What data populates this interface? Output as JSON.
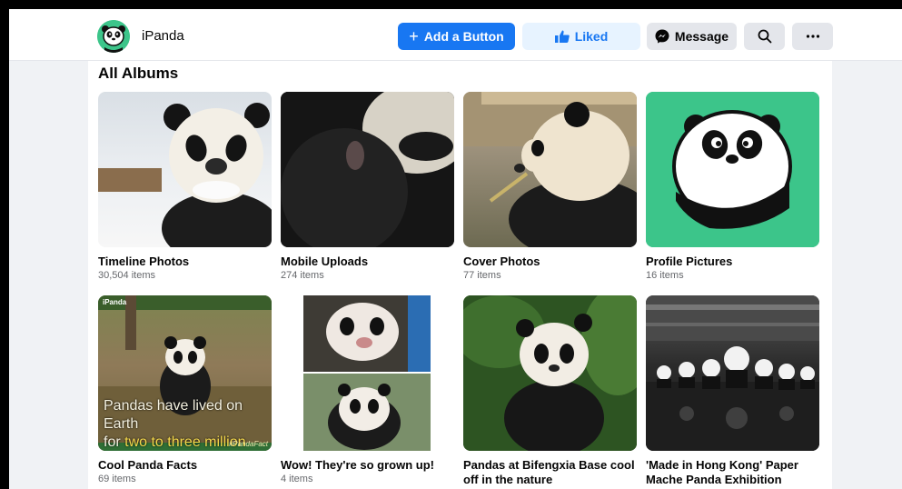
{
  "page": {
    "name": "iPanda"
  },
  "actions": {
    "add_button": "Add a Button",
    "liked": "Liked",
    "message": "Message"
  },
  "section": {
    "title": "All Albums"
  },
  "albums": [
    {
      "title": "Timeline Photos",
      "count": "30,504 items"
    },
    {
      "title": "Mobile Uploads",
      "count": "274 items"
    },
    {
      "title": "Cover Photos",
      "count": "77 items"
    },
    {
      "title": "Profile Pictures",
      "count": "16 items"
    },
    {
      "title": "Cool Panda Facts",
      "count": "69 items"
    },
    {
      "title": "Wow! They're so grown up!",
      "count": "4 items"
    },
    {
      "title": "Pandas at Bifengxia Base cool off in the nature",
      "count": ""
    },
    {
      "title": "'Made in Hong Kong' Paper Mache Panda Exhibition",
      "count": ""
    }
  ],
  "fact_overlay": {
    "line1": "Pandas have lived on Earth",
    "line2_prefix": "for ",
    "line2_highlight": "two to three million years",
    "tag": "#PandaFact",
    "brand": "iPanda"
  },
  "colors": {
    "primary": "#1877f2",
    "liked_bg": "#e7f3ff",
    "brand_green": "#3cc58a"
  }
}
